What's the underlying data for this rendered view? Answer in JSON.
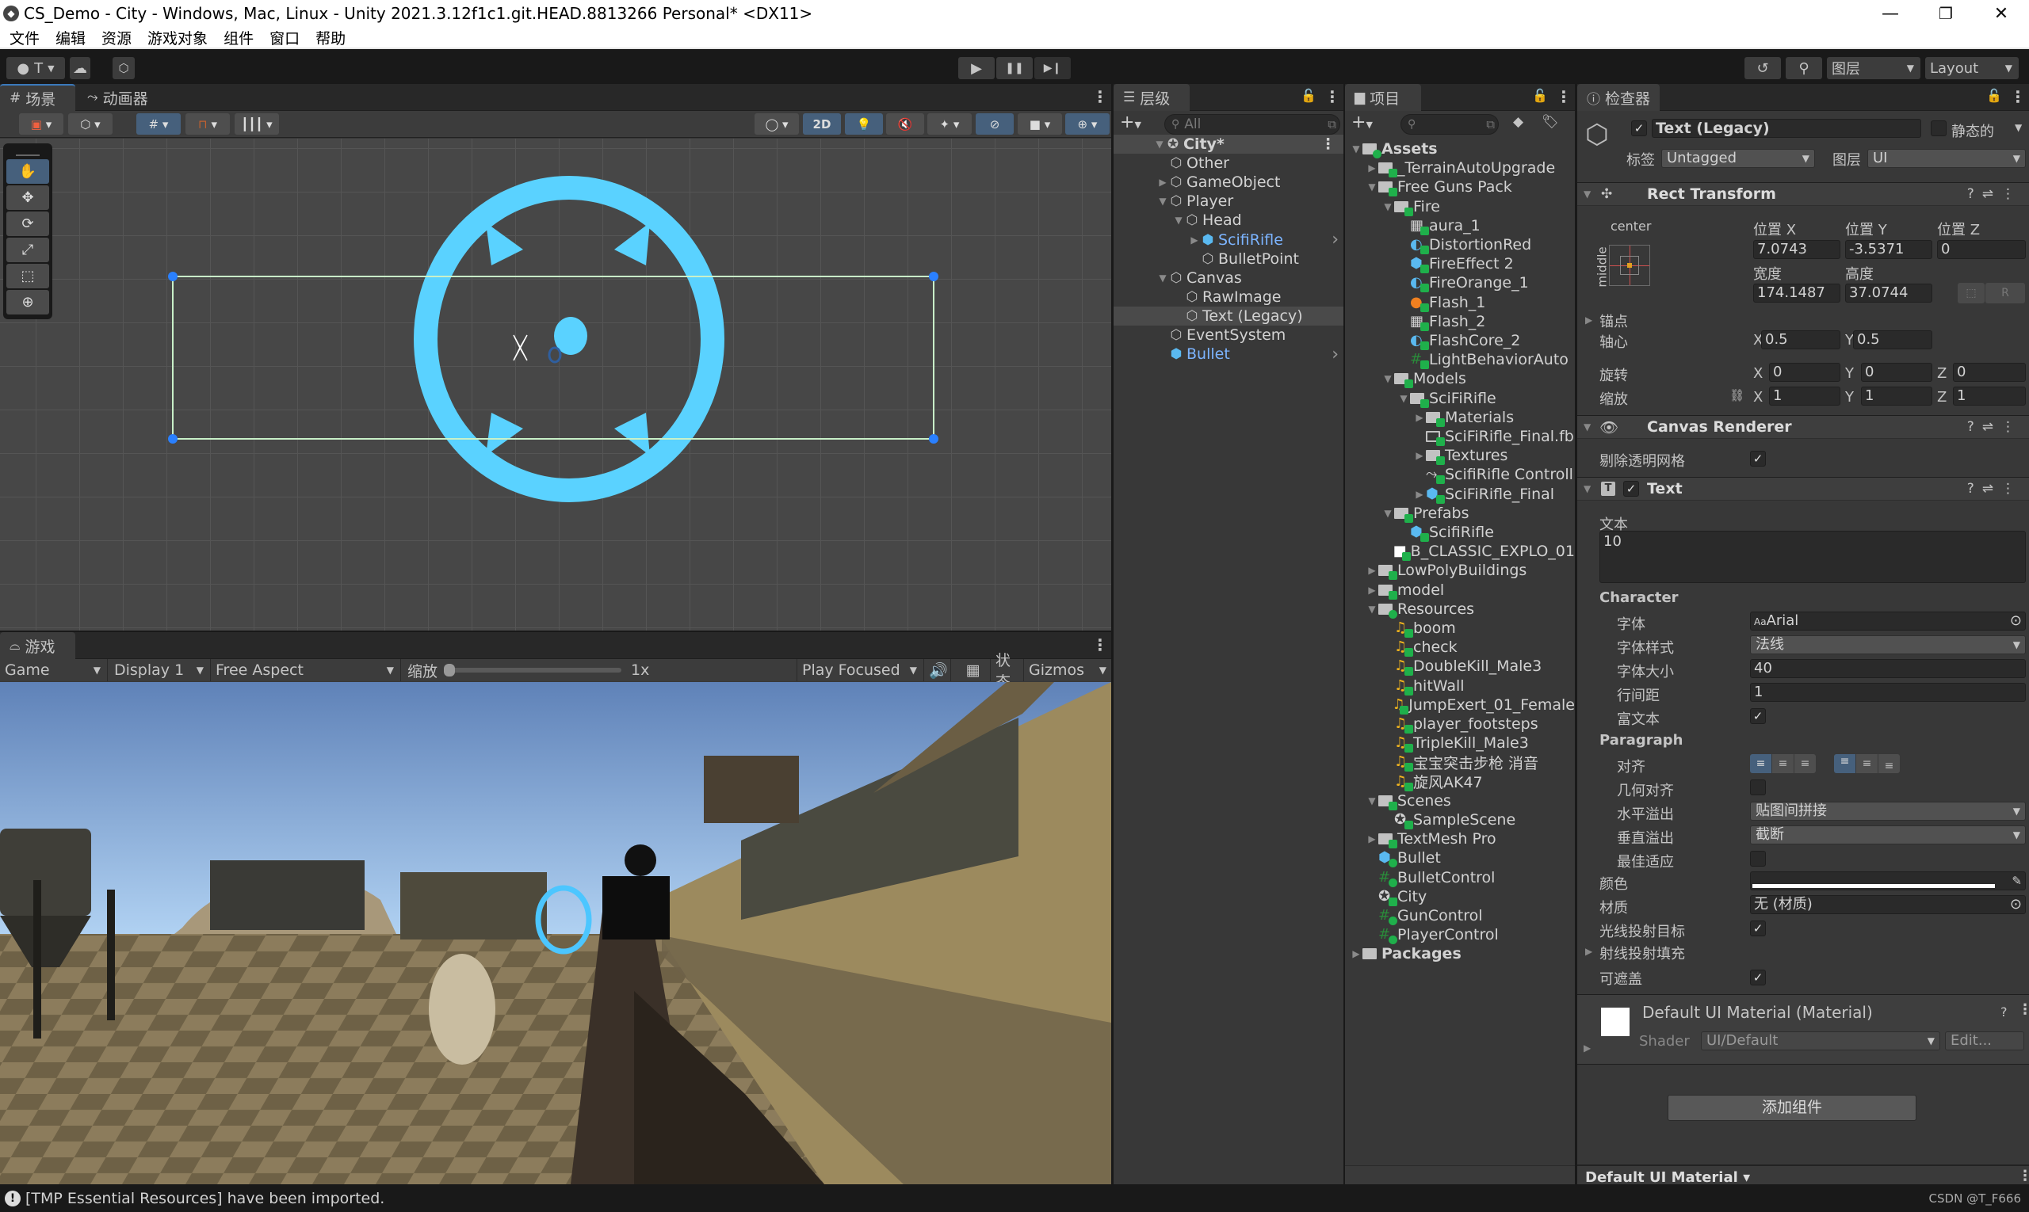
{
  "window": {
    "title": "CS_Demo - City - Windows, Mac, Linux - Unity 2021.3.12f1c1.git.HEAD.8813266 Personal* <DX11>",
    "controls": {
      "minimize": "—",
      "maximize": "❐",
      "close": "✕"
    }
  },
  "menu": [
    "文件",
    "编辑",
    "资源",
    "游戏对象",
    "组件",
    "窗口",
    "帮助"
  ],
  "toolbar": {
    "account_label": "T",
    "play_icon": "▶",
    "pause_icon": "❚❚",
    "step_icon": "▶❙",
    "history_icon": "↺",
    "search_icon": "⚲",
    "layers_label": "图层",
    "layout_label": "Layout"
  },
  "scene": {
    "tabs": [
      {
        "label": "场景",
        "icon": "#"
      },
      {
        "label": "动画器",
        "icon": "⤳"
      }
    ],
    "toolbar": {
      "mode_2d": "2D"
    },
    "tools": [
      "hand",
      "move",
      "rotate",
      "scale",
      "rect",
      "transform"
    ],
    "crosshair_color": "#5ad2ff"
  },
  "game": {
    "tab_label": "游戏",
    "toolbar": {
      "view": "Game",
      "display": "Display 1",
      "aspect": "Free Aspect",
      "scale_label": "缩放",
      "scale_value": "1x",
      "scale_fraction": 0.0,
      "play_mode": "Play Focused",
      "stats": "状态",
      "gizmos": "Gizmos"
    }
  },
  "hierarchy": {
    "tab_label": "层级",
    "search_placeholder": "All",
    "items": [
      {
        "label": "City*",
        "depth": 0,
        "arrow": "down",
        "icon": "scene",
        "bold": true
      },
      {
        "label": "Other",
        "depth": 1,
        "arrow": "none",
        "icon": "cube"
      },
      {
        "label": "GameObject",
        "depth": 1,
        "arrow": "right",
        "icon": "cube"
      },
      {
        "label": "Player",
        "depth": 1,
        "arrow": "down",
        "icon": "cube"
      },
      {
        "label": "Head",
        "depth": 2,
        "arrow": "down",
        "icon": "cube"
      },
      {
        "label": "ScifiRifle",
        "depth": 3,
        "arrow": "right",
        "icon": "prefab",
        "prefab": true
      },
      {
        "label": "BulletPoint",
        "depth": 3,
        "arrow": "none",
        "icon": "cube"
      },
      {
        "label": "Canvas",
        "depth": 1,
        "arrow": "down",
        "icon": "cube"
      },
      {
        "label": "RawImage",
        "depth": 2,
        "arrow": "none",
        "icon": "cube"
      },
      {
        "label": "Text (Legacy)",
        "depth": 2,
        "arrow": "none",
        "icon": "cube",
        "selected": true
      },
      {
        "label": "EventSystem",
        "depth": 1,
        "arrow": "none",
        "icon": "cube"
      },
      {
        "label": "Bullet",
        "depth": 1,
        "arrow": "none",
        "icon": "prefab",
        "prefab": true
      }
    ]
  },
  "project": {
    "tab_label": "项目",
    "items": [
      {
        "label": "Assets",
        "depth": 0,
        "arrow": "down",
        "icon": "folder-open",
        "bold": true,
        "badge": "plus"
      },
      {
        "label": "_TerrainAutoUpgrade",
        "depth": 1,
        "arrow": "right",
        "icon": "folder"
      },
      {
        "label": "Free Guns Pack",
        "depth": 1,
        "arrow": "down",
        "icon": "folder-open"
      },
      {
        "label": "Fire",
        "depth": 2,
        "arrow": "down",
        "icon": "folder-open"
      },
      {
        "label": "aura_1",
        "depth": 3,
        "arrow": "none",
        "icon": "texture"
      },
      {
        "label": "DistortionRed",
        "depth": 3,
        "arrow": "none",
        "icon": "material"
      },
      {
        "label": "FireEffect 2",
        "depth": 3,
        "arrow": "none",
        "icon": "prefab"
      },
      {
        "label": "FireOrange_1",
        "depth": 3,
        "arrow": "none",
        "icon": "material"
      },
      {
        "label": "Flash_1",
        "depth": 3,
        "arrow": "none",
        "icon": "texture-fire"
      },
      {
        "label": "Flash_2",
        "depth": 3,
        "arrow": "none",
        "icon": "texture"
      },
      {
        "label": "FlashCore_2",
        "depth": 3,
        "arrow": "none",
        "icon": "material"
      },
      {
        "label": "LightBehaviorAuto",
        "depth": 3,
        "arrow": "none",
        "icon": "script"
      },
      {
        "label": "Models",
        "depth": 2,
        "arrow": "down",
        "icon": "folder-open"
      },
      {
        "label": "SciFiRifle",
        "depth": 3,
        "arrow": "down",
        "icon": "folder-open"
      },
      {
        "label": "Materials",
        "depth": 4,
        "arrow": "right",
        "icon": "folder"
      },
      {
        "label": "SciFiRifle_Final.fb",
        "depth": 4,
        "arrow": "none",
        "icon": "folder-empty"
      },
      {
        "label": "Textures",
        "depth": 4,
        "arrow": "right",
        "icon": "folder"
      },
      {
        "label": "ScifiRifle Controll",
        "depth": 4,
        "arrow": "none",
        "icon": "animator"
      },
      {
        "label": "SciFiRifle_Final",
        "depth": 4,
        "arrow": "right",
        "icon": "model"
      },
      {
        "label": "Prefabs",
        "depth": 2,
        "arrow": "down",
        "icon": "folder-open"
      },
      {
        "label": "ScifiRifle",
        "depth": 3,
        "arrow": "none",
        "icon": "prefab"
      },
      {
        "label": "B_CLASSIC_EXPLO_01",
        "depth": 2,
        "arrow": "none",
        "icon": "white"
      },
      {
        "label": "LowPolyBuildings",
        "depth": 1,
        "arrow": "right",
        "icon": "folder"
      },
      {
        "label": "model",
        "depth": 1,
        "arrow": "right",
        "icon": "folder"
      },
      {
        "label": "Resources",
        "depth": 1,
        "arrow": "down",
        "icon": "folder-open",
        "badge": "plus"
      },
      {
        "label": "boom",
        "depth": 2,
        "arrow": "none",
        "icon": "audio"
      },
      {
        "label": "check",
        "depth": 2,
        "arrow": "none",
        "icon": "audio"
      },
      {
        "label": "DoubleKill_Male3",
        "depth": 2,
        "arrow": "none",
        "icon": "audio"
      },
      {
        "label": "hitWall",
        "depth": 2,
        "arrow": "none",
        "icon": "audio"
      },
      {
        "label": "JumpExert_01_Female",
        "depth": 2,
        "arrow": "none",
        "icon": "audio"
      },
      {
        "label": "player_footsteps",
        "depth": 2,
        "arrow": "none",
        "icon": "audio"
      },
      {
        "label": "TripleKill_Male3",
        "depth": 2,
        "arrow": "none",
        "icon": "audio"
      },
      {
        "label": "宝宝突击步枪 消音",
        "depth": 2,
        "arrow": "none",
        "icon": "audio"
      },
      {
        "label": "旋风AK47",
        "depth": 2,
        "arrow": "none",
        "icon": "audio"
      },
      {
        "label": "Scenes",
        "depth": 1,
        "arrow": "down",
        "icon": "folder-open"
      },
      {
        "label": "SampleScene",
        "depth": 2,
        "arrow": "none",
        "icon": "scene"
      },
      {
        "label": "TextMesh Pro",
        "depth": 1,
        "arrow": "right",
        "icon": "folder"
      },
      {
        "label": "Bullet",
        "depth": 1,
        "arrow": "none",
        "icon": "prefab",
        "badge": "plus"
      },
      {
        "label": "BulletControl",
        "depth": 1,
        "arrow": "none",
        "icon": "script",
        "badge": "plus"
      },
      {
        "label": "City",
        "depth": 1,
        "arrow": "none",
        "icon": "scene"
      },
      {
        "label": "GunControl",
        "depth": 1,
        "arrow": "none",
        "icon": "script",
        "badge": "plus"
      },
      {
        "label": "PlayerControl",
        "depth": 1,
        "arrow": "none",
        "icon": "script",
        "badge": "plus"
      },
      {
        "label": "Packages",
        "depth": 0,
        "arrow": "right",
        "icon": "folder",
        "bold": true,
        "badge": "none"
      }
    ]
  },
  "inspector": {
    "tab_label": "检查器",
    "object": {
      "active": true,
      "name": "Text (Legacy)",
      "static_label": "静态的",
      "static": false,
      "tag_label": "标签",
      "tag": "Untagged",
      "layer_label": "图层",
      "layer": "UI"
    },
    "rect_transform": {
      "title": "Rect Transform",
      "anchor_h": "center",
      "anchor_v": "middle",
      "pos_x_label": "位置 X",
      "pos_y_label": "位置 Y",
      "pos_z_label": "位置 Z",
      "pos_x": "7.0743",
      "pos_y": "-3.5371",
      "pos_z": "0",
      "width_label": "宽度",
      "height_label": "高度",
      "width": "174.1487",
      "height": "37.0744",
      "anchors_label": "锚点",
      "pivot_label": "轴心",
      "pivot_x": "0.5",
      "pivot_y": "0.5",
      "rotation_label": "旋转",
      "rot_x": "0",
      "rot_y": "0",
      "rot_z": "0",
      "scale_label": "缩放",
      "scale_x": "1",
      "scale_y": "1",
      "scale_z": "1",
      "raw_btn": "R"
    },
    "canvas_renderer": {
      "title": "Canvas Renderer",
      "cull_label": "剔除透明网格",
      "cull": true
    },
    "text": {
      "title": "Text",
      "enabled": true,
      "text_label": "文本",
      "text_value": "10",
      "character_label": "Character",
      "font_label": "字体",
      "font": "Arial",
      "font_style_label": "字体样式",
      "font_style": "法线",
      "font_size_label": "字体大小",
      "font_size": "40",
      "line_spacing_label": "行间距",
      "line_spacing": "1",
      "rich_text_label": "富文本",
      "rich_text": true,
      "paragraph_label": "Paragraph",
      "alignment_label": "对齐",
      "align_by_geometry_label": "几何对齐",
      "align_by_geometry": false,
      "horizontal_overflow_label": "水平溢出",
      "horizontal_overflow": "贴图间拼接",
      "vertical_overflow_label": "垂直溢出",
      "vertical_overflow": "截断",
      "best_fit_label": "最佳适应",
      "best_fit": false,
      "color_label": "颜色",
      "color": "#ffffff",
      "material_label": "材质",
      "material": "无 (材质)",
      "raycast_target_label": "光线投射目标",
      "raycast_target": true,
      "raycast_padding_label": "射线投射填充",
      "maskable_label": "可遮盖",
      "maskable": true
    },
    "material": {
      "name": "Default UI Material (Material)",
      "shader_label": "Shader",
      "shader": "UI/Default",
      "edit_label": "Edit..."
    },
    "add_component": "添加组件",
    "preview_label": "Default UI Material"
  },
  "status": {
    "message": "[TMP Essential Resources] have been imported.",
    "watermark": "CSDN @T_F666"
  }
}
